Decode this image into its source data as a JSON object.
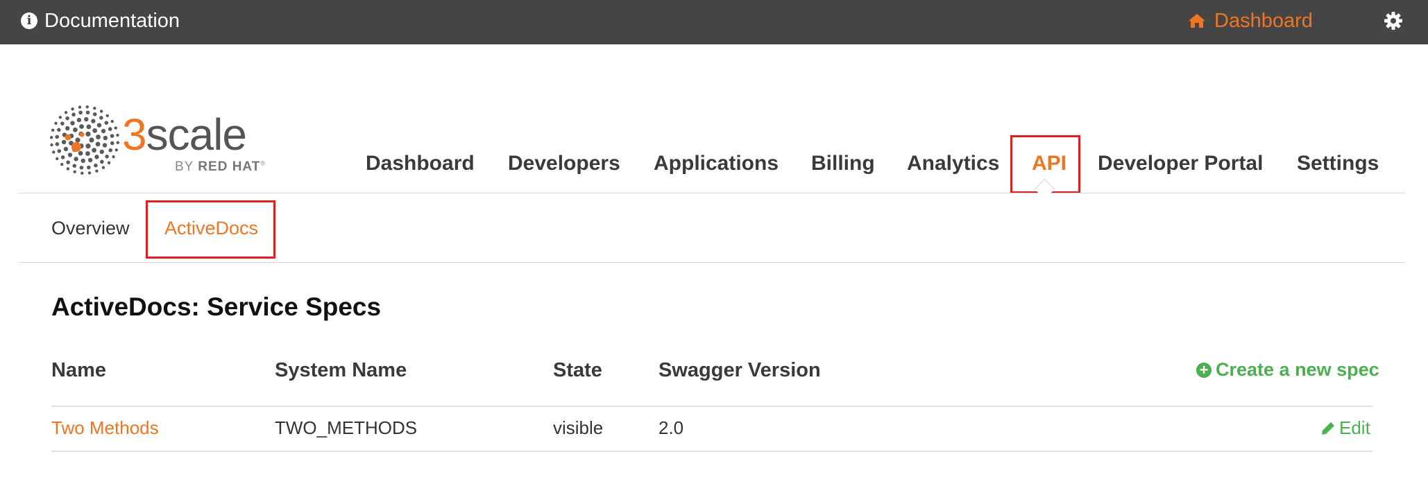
{
  "topbar": {
    "documentation_label": "Documentation",
    "dashboard_label": "Dashboard",
    "accent_color": "#ee7623",
    "background_color": "#454545"
  },
  "logo": {
    "number": "3",
    "word": "scale",
    "tagline_by": "BY",
    "tagline_brand": "RED HAT",
    "tagline_mark": "®"
  },
  "main_nav": {
    "items": [
      {
        "label": "Dashboard",
        "active": false
      },
      {
        "label": "Developers",
        "active": false
      },
      {
        "label": "Applications",
        "active": false
      },
      {
        "label": "Billing",
        "active": false
      },
      {
        "label": "Analytics",
        "active": false
      },
      {
        "label": "API",
        "active": true
      },
      {
        "label": "Developer Portal",
        "active": false
      },
      {
        "label": "Settings",
        "active": false
      }
    ]
  },
  "sub_nav": {
    "items": [
      {
        "label": "Overview",
        "active": false
      },
      {
        "label": "ActiveDocs",
        "active": true
      }
    ]
  },
  "content": {
    "title": "ActiveDocs: Service Specs",
    "create_label": "Create a new spec",
    "table": {
      "columns": [
        "Name",
        "System Name",
        "State",
        "Swagger Version"
      ],
      "rows": [
        {
          "name": "Two Methods",
          "system_name": "TWO_METHODS",
          "state": "visible",
          "swagger_version": "2.0",
          "action": "Edit"
        }
      ]
    }
  }
}
